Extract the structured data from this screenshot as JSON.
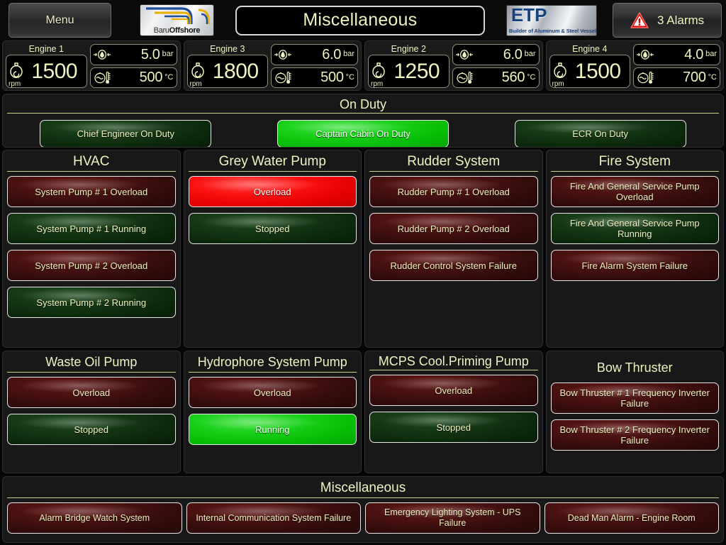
{
  "header": {
    "menu_label": "Menu",
    "page_title": "Miscellaneous",
    "alarm_count_label": "3 Alarms",
    "warning_icon": "warning-triangle-icon",
    "baru_logo": {
      "text_light": "Baru",
      "text_bold": "Offshore"
    },
    "etp_logo": {
      "main": "ETP",
      "tagline": "Builder of Aluminum & Steel Vessels"
    }
  },
  "engines": [
    {
      "name": "Engine 1",
      "rpm": "1500",
      "rpm_unit": "rpm",
      "pressure": "5.0",
      "pressure_unit": "bar",
      "temperature": "500",
      "temperature_unit": "°C"
    },
    {
      "name": "Engine 3",
      "rpm": "1800",
      "rpm_unit": "rpm",
      "pressure": "6.0",
      "pressure_unit": "bar",
      "temperature": "500",
      "temperature_unit": "°C"
    },
    {
      "name": "Engine 2",
      "rpm": "1250",
      "rpm_unit": "rpm",
      "pressure": "6.0",
      "pressure_unit": "bar",
      "temperature": "560",
      "temperature_unit": "°C"
    },
    {
      "name": "Engine 4",
      "rpm": "1500",
      "rpm_unit": "rpm",
      "pressure": "4.0",
      "pressure_unit": "bar",
      "temperature": "700",
      "temperature_unit": "°C"
    }
  ],
  "on_duty": {
    "title": "On Duty",
    "items": [
      {
        "label": "Chief Engineer On Duty",
        "state": "off"
      },
      {
        "label": "Captain Cabin On Duty",
        "state": "on"
      },
      {
        "label": "ECR On Duty",
        "state": "off"
      }
    ]
  },
  "panels_row1": [
    {
      "title": "HVAC",
      "items": [
        {
          "label": "System Pump # 1 Overload",
          "type": "alarm",
          "state": "off"
        },
        {
          "label": "System Pump # 1 Running",
          "type": "status",
          "state": "off"
        },
        {
          "label": "System Pump # 2 Overload",
          "type": "alarm",
          "state": "off"
        },
        {
          "label": "System Pump # 2 Running",
          "type": "status",
          "state": "off"
        }
      ]
    },
    {
      "title": "Grey Water Pump",
      "items": [
        {
          "label": "Overload",
          "type": "alarm",
          "state": "on"
        },
        {
          "label": "Stopped",
          "type": "status",
          "state": "off"
        }
      ]
    },
    {
      "title": "Rudder System",
      "items": [
        {
          "label": "Rudder Pump # 1 Overload",
          "type": "alarm",
          "state": "off"
        },
        {
          "label": "Rudder Pump # 2 Overload",
          "type": "alarm",
          "state": "off"
        },
        {
          "label": "Rudder Control System Failure",
          "type": "alarm",
          "state": "off"
        }
      ]
    },
    {
      "title": "Fire System",
      "items": [
        {
          "label": "Fire And General Service Pump Overload",
          "type": "alarm",
          "state": "off"
        },
        {
          "label": "Fire And General Service Pump Running",
          "type": "status",
          "state": "off"
        },
        {
          "label": "Fire Alarm System Failure",
          "type": "alarm",
          "state": "off"
        }
      ]
    }
  ],
  "panels_row2": [
    {
      "title": "Waste Oil Pump",
      "items": [
        {
          "label": "Overload",
          "type": "alarm",
          "state": "off"
        },
        {
          "label": "Stopped",
          "type": "status",
          "state": "off"
        }
      ]
    },
    {
      "title": "Hydrophore System Pump",
      "items": [
        {
          "label": "Overload",
          "type": "alarm",
          "state": "off"
        },
        {
          "label": "Running",
          "type": "status",
          "state": "on"
        }
      ]
    },
    {
      "title": "MCPS Cool.Priming Pump",
      "items": [
        {
          "label": "Overload",
          "type": "alarm",
          "state": "off"
        },
        {
          "label": "Stopped",
          "type": "status",
          "state": "off"
        }
      ]
    },
    {
      "title": "Bow Thruster",
      "items": [
        {
          "label": "Bow Thruster # 1 Frequency Inverter Failure",
          "type": "alarm",
          "state": "off"
        },
        {
          "label": "Bow Thruster # 2 Frequency Inverter Failure",
          "type": "alarm",
          "state": "off"
        }
      ]
    }
  ],
  "miscellaneous": {
    "title": "Miscellaneous",
    "items": [
      {
        "label": "Alarm Bridge Watch System",
        "type": "alarm",
        "state": "off"
      },
      {
        "label": "Internal Communication System Failure",
        "type": "alarm",
        "state": "off"
      },
      {
        "label": "Emergency Lighting System - UPS Failure",
        "type": "alarm",
        "state": "off"
      },
      {
        "label": "Dead Man Alarm - Engine Room",
        "type": "alarm",
        "state": "off"
      }
    ]
  },
  "colors": {
    "accent_text": "#eff2c0",
    "alarm_on": "#ee0000",
    "alarm_off": "#4a1111",
    "status_on": "#16cf16",
    "status_off": "#163816",
    "panel_bg": "#181818",
    "page_bg": "#060606"
  }
}
